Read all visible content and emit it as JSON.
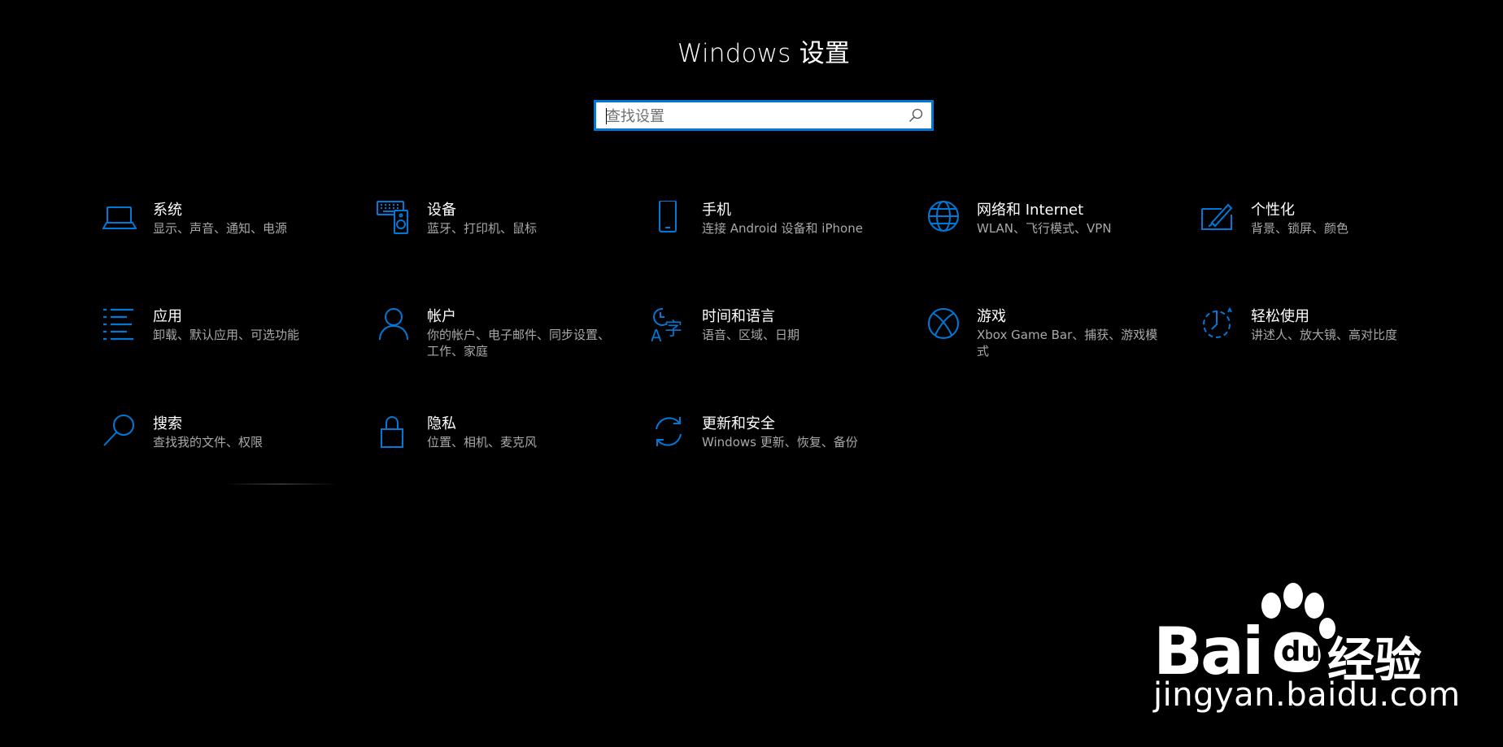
{
  "window": {
    "title": "Windows 设置"
  },
  "search": {
    "placeholder": "查找设置",
    "value": ""
  },
  "accent_color": "#0078d7",
  "categories": [
    {
      "title": "系统",
      "desc": "显示、声音、通知、电源",
      "icon": "laptop-icon"
    },
    {
      "title": "设备",
      "desc": "蓝牙、打印机、鼠标",
      "icon": "keyboard-speaker-icon"
    },
    {
      "title": "手机",
      "desc": "连接 Android 设备和 iPhone",
      "icon": "phone-icon"
    },
    {
      "title": "网络和 Internet",
      "desc": "WLAN、飞行模式、VPN",
      "icon": "globe-icon"
    },
    {
      "title": "个性化",
      "desc": "背景、锁屏、颜色",
      "icon": "paint-brush-icon"
    },
    {
      "title": "应用",
      "desc": "卸载、默认应用、可选功能",
      "icon": "apps-list-icon"
    },
    {
      "title": "帐户",
      "desc": "你的帐户、电子邮件、同步设置、工作、家庭",
      "icon": "person-icon"
    },
    {
      "title": "时间和语言",
      "desc": "语音、区域、日期",
      "icon": "time-language-icon"
    },
    {
      "title": "游戏",
      "desc": "Xbox Game Bar、捕获、游戏模式",
      "icon": "xbox-icon"
    },
    {
      "title": "轻松使用",
      "desc": "讲述人、放大镜、高对比度",
      "icon": "ease-of-access-icon"
    },
    {
      "title": "搜索",
      "desc": "查找我的文件、权限",
      "icon": "search-icon"
    },
    {
      "title": "隐私",
      "desc": "位置、相机、麦克风",
      "icon": "lock-icon"
    },
    {
      "title": "更新和安全",
      "desc": "Windows 更新、恢复、备份",
      "icon": "sync-icon"
    }
  ],
  "watermark": {
    "brand_latin": "Bai",
    "brand_cn": "经验",
    "url": "jingyan.baidu.com"
  }
}
